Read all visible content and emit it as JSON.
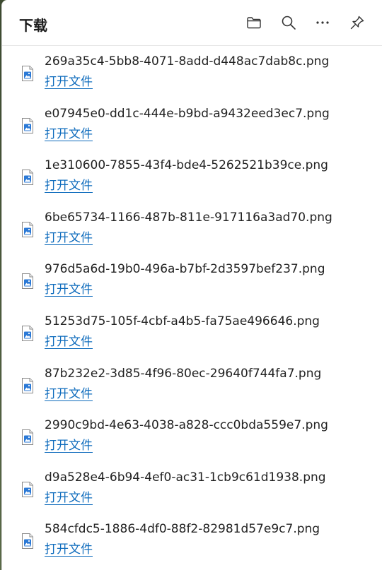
{
  "header": {
    "title": "下载"
  },
  "icons": {
    "folder": "folder-icon",
    "search": "search-icon",
    "more": "more-icon",
    "pin": "pin-icon",
    "file": "image-file-icon"
  },
  "colors": {
    "link": "#0f6cbd",
    "text": "#222222",
    "accent_top": "#d84040"
  },
  "downloads": [
    {
      "filename": "269a35c4-5bb8-4071-8add-d448ac7dab8c.png",
      "action": "打开文件"
    },
    {
      "filename": "e07945e0-dd1c-444e-b9bd-a9432eed3ec7.png",
      "action": "打开文件"
    },
    {
      "filename": "1e310600-7855-43f4-bde4-5262521b39ce.png",
      "action": "打开文件"
    },
    {
      "filename": "6be65734-1166-487b-811e-917116a3ad70.png",
      "action": "打开文件"
    },
    {
      "filename": "976d5a6d-19b0-496a-b7bf-2d3597bef237.png",
      "action": "打开文件"
    },
    {
      "filename": "51253d75-105f-4cbf-a4b5-fa75ae496646.png",
      "action": "打开文件"
    },
    {
      "filename": "87b232e2-3d85-4f96-80ec-29640f744fa7.png",
      "action": "打开文件"
    },
    {
      "filename": "2990c9bd-4e63-4038-a828-ccc0bda559e7.png",
      "action": "打开文件"
    },
    {
      "filename": "d9a528e4-6b94-4ef0-ac31-1cb9c61d1938.png",
      "action": "打开文件"
    },
    {
      "filename": "584cfdc5-1886-4df0-88f2-82981d57e9c7.png",
      "action": "打开文件"
    }
  ]
}
